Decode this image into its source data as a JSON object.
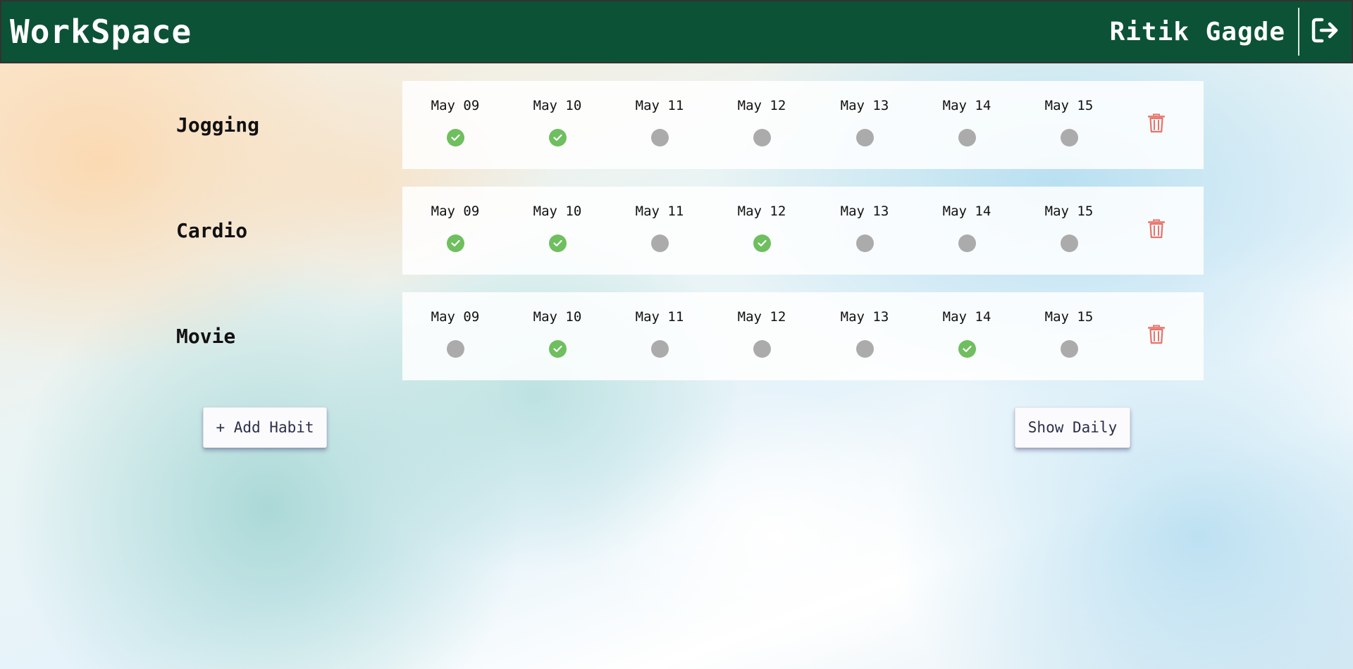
{
  "header": {
    "brand": "WorkSpace",
    "user_name": "Ritik Gagde",
    "logout_icon": "logout-icon"
  },
  "habits": [
    {
      "name": "Jogging",
      "days": [
        {
          "label": "May 09",
          "done": true
        },
        {
          "label": "May 10",
          "done": true
        },
        {
          "label": "May 11",
          "done": false
        },
        {
          "label": "May 12",
          "done": false
        },
        {
          "label": "May 13",
          "done": false
        },
        {
          "label": "May 14",
          "done": false
        },
        {
          "label": "May 15",
          "done": false
        }
      ]
    },
    {
      "name": "Cardio",
      "days": [
        {
          "label": "May 09",
          "done": true
        },
        {
          "label": "May 10",
          "done": true
        },
        {
          "label": "May 11",
          "done": false
        },
        {
          "label": "May 12",
          "done": true
        },
        {
          "label": "May 13",
          "done": false
        },
        {
          "label": "May 14",
          "done": false
        },
        {
          "label": "May 15",
          "done": false
        }
      ]
    },
    {
      "name": "Movie",
      "days": [
        {
          "label": "May 09",
          "done": false
        },
        {
          "label": "May 10",
          "done": true
        },
        {
          "label": "May 11",
          "done": false
        },
        {
          "label": "May 12",
          "done": false
        },
        {
          "label": "May 13",
          "done": false
        },
        {
          "label": "May 14",
          "done": true
        },
        {
          "label": "May 15",
          "done": false
        }
      ]
    }
  ],
  "actions": {
    "add_habit_label": "+ Add Habit",
    "show_daily_label": "Show Daily"
  },
  "colors": {
    "header_bg": "#0c5236",
    "done": "#6fbe5f",
    "pending": "#ababab",
    "delete": "#e8736a"
  },
  "icons": {
    "delete": "trash-icon",
    "done": "check-icon"
  }
}
